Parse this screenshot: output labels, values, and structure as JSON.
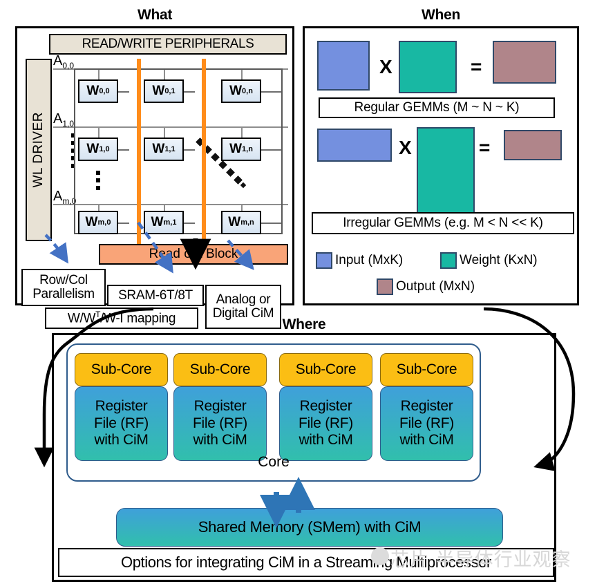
{
  "panels": {
    "what": {
      "title": "What",
      "peripherals_label": "READ/WRITE PERIPHERALS",
      "wl_driver_label": "WL DRIVER",
      "address_labels": [
        "A0,0",
        "A1,0",
        "Am,0"
      ],
      "cells": [
        [
          "W0,0",
          "W0,1",
          "W0,n"
        ],
        [
          "W1,0",
          "W1,1",
          "W1,n"
        ],
        [
          "Wm,0",
          "Wm,1",
          "Wm,n"
        ]
      ],
      "readout_label": "Read out Block",
      "annotations": {
        "row_col_line1": "Row/Col",
        "row_col_line2": "Parallelism",
        "sram": "SRAM-6T/8T",
        "mapping_pre": "W/W",
        "mapping_sup": "T",
        "mapping_post": "/W-I mapping",
        "analog_line1": "Analog or",
        "analog_line2": "Digital CiM"
      }
    },
    "when": {
      "title": "When",
      "row1": {
        "operator_multiply": "X",
        "operator_equals": "=",
        "caption": "Regular GEMMs (M ~ N ~ K)"
      },
      "row2": {
        "operator_multiply": "X",
        "operator_equals": "=",
        "caption": "Irregular GEMMs (e.g. M < N << K)"
      },
      "legend": [
        {
          "label": "Input (MxK)",
          "color": "#7490DF"
        },
        {
          "label": "Weight (KxN)",
          "color": "#18B8A3"
        },
        {
          "label": "Output (MxN)",
          "color": "#B0858A"
        }
      ]
    },
    "where": {
      "title": "Where",
      "subcores": [
        "Sub-Core",
        "Sub-Core",
        "Sub-Core",
        "Sub-Core"
      ],
      "register_files": [
        {
          "l1": "Register",
          "l2": "File (RF)",
          "l3": "with CiM"
        },
        {
          "l1": "Register",
          "l2": "File (RF)",
          "l3": "with CiM"
        },
        {
          "l1": "Register",
          "l2": "File (RF)",
          "l3": "with CiM"
        },
        {
          "l1": "Register",
          "l2": "File (RF)",
          "l3": "with CiM"
        }
      ],
      "core_label": "Core",
      "shared_memory_label": "Shared Memory (SMem) with CiM",
      "options_label": "Options for integrating CiM in a Streaming Multiprocessor"
    }
  },
  "watermark": {
    "text": "芯片 半导体行业观察"
  },
  "colors": {
    "bitline_orange": "#FF8C1A",
    "readout_salmon": "#F9A478",
    "peripheral_beige": "#E8E2D5",
    "subcore_amber": "#FBBE14",
    "rf_gradient_top": "#3FA0DA",
    "rf_gradient_bottom": "#31BFAC",
    "dashed_arrow_blue": "#4472C4",
    "core_arrow_blue": "#2E75B6"
  }
}
